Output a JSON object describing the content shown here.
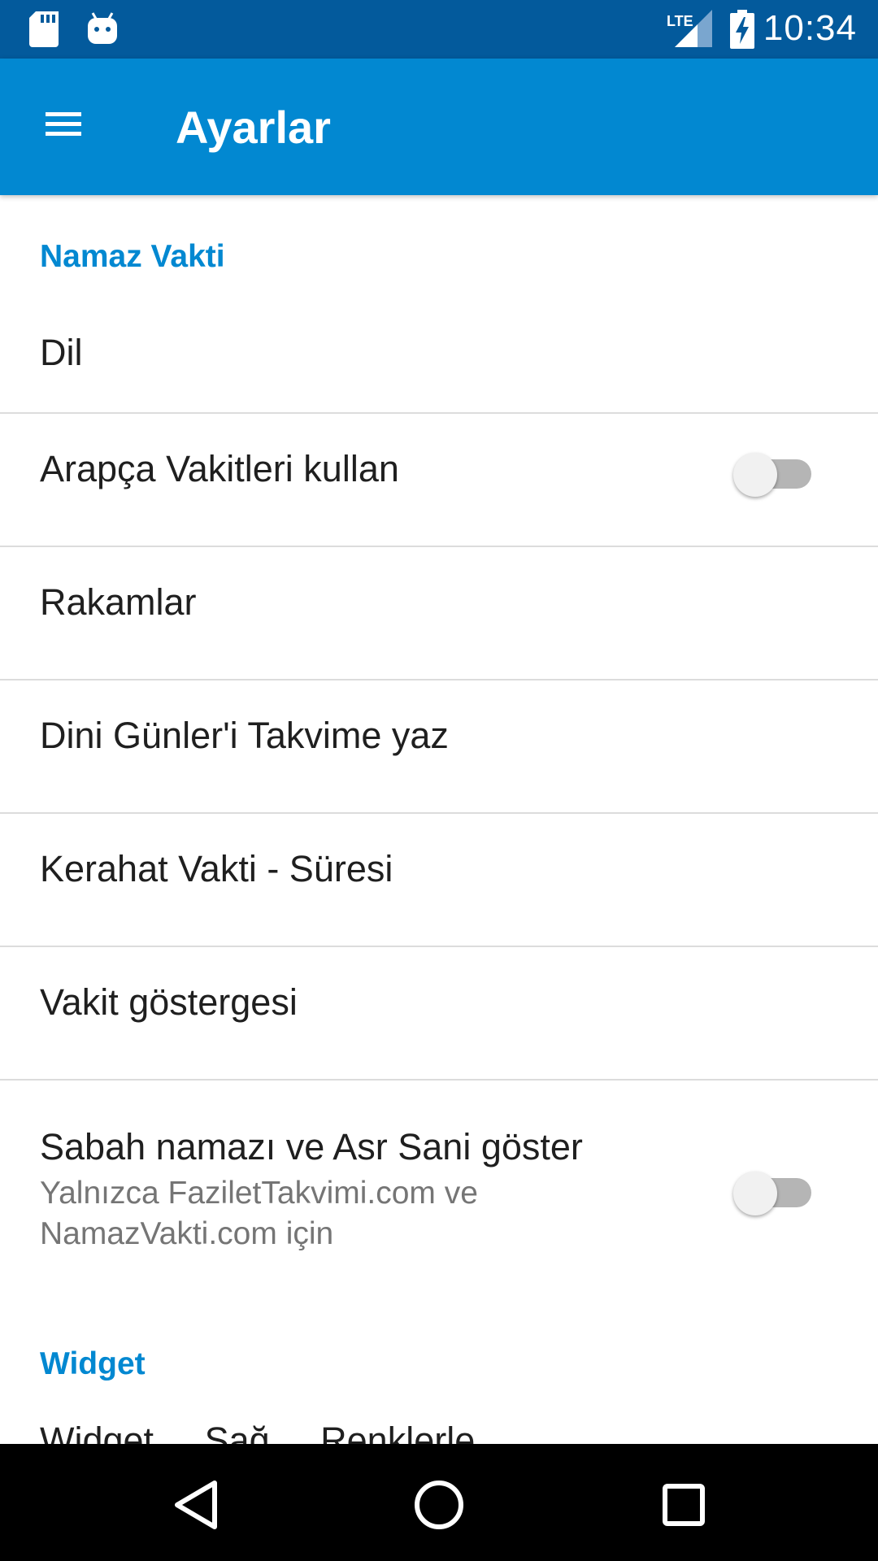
{
  "status_bar": {
    "time": "10:34",
    "network_label": "LTE",
    "icons": [
      "sd-card-icon",
      "android-icon",
      "lte-signal-icon",
      "battery-charging-icon"
    ]
  },
  "app_bar": {
    "title": "Ayarlar",
    "menu_icon": "hamburger-menu-icon"
  },
  "sections": [
    {
      "header": "Namaz Vakti",
      "items": [
        {
          "title": "Dil"
        },
        {
          "title": "Arapça Vakitleri kullan",
          "switch": false
        },
        {
          "title": "Rakamlar"
        },
        {
          "title": "Dini Günler'i Takvime yaz"
        },
        {
          "title": "Kerahat Vakti - Süresi"
        },
        {
          "title": "Vakit göstergesi"
        },
        {
          "title": "Sabah namazı ve Asr Sani göster",
          "summary": "Yalnızca FaziletTakvimi.com ve NamazVakti.com için",
          "switch": false
        }
      ]
    },
    {
      "header": "Widget",
      "items": [
        {
          "title": "Widget ... Sağ ... Renklerle"
        }
      ]
    }
  ],
  "nav_bar": {
    "buttons": [
      "back-icon",
      "home-icon",
      "recents-icon"
    ]
  },
  "colors": {
    "status_bar": "#035a9c",
    "app_bar": "#0288d1",
    "accent": "#0288d1",
    "nav_bar": "#000000"
  }
}
